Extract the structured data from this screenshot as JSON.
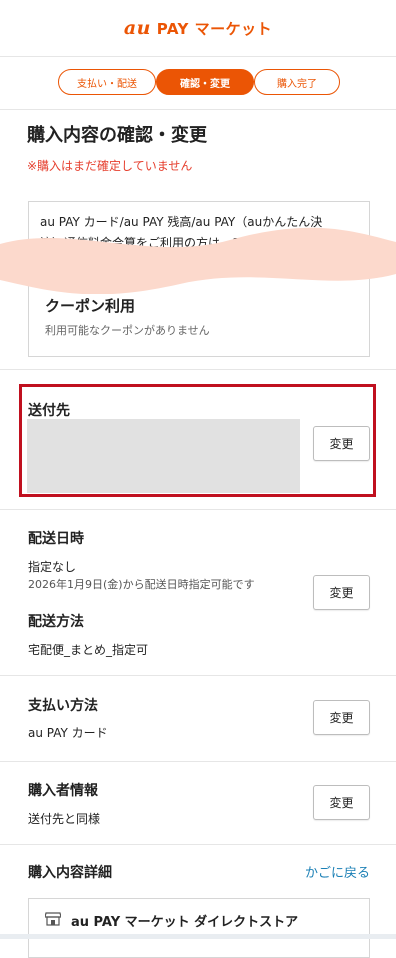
{
  "header": {
    "logo_au": "au",
    "logo_text": "PAY マーケット"
  },
  "steps": [
    {
      "label": "支払い・配送"
    },
    {
      "label": "確認・変更"
    },
    {
      "label": "購入完了"
    }
  ],
  "page": {
    "title": "購入内容の確認・変更",
    "warning": "※購入はまだ確定していません",
    "warning_color": "#e63f2e",
    "accent_color": "#eb5505"
  },
  "notice": {
    "line1": "au PAY カード/au PAY 残高/au PAY（auかんたん決",
    "line2": "済）通信料金合算をご利用の方は、SMSをお客様のス"
  },
  "coupon": {
    "title": "クーポン利用",
    "subtitle": "利用可能なクーポンがありません"
  },
  "shipping_address": {
    "title": "送付先",
    "change_label": "変更"
  },
  "delivery": {
    "date_title": "配送日時",
    "date_value": "指定なし",
    "date_note": "2026年1月9日(金)から配送日時指定可能です",
    "method_title": "配送方法",
    "method_value": "宅配便_まとめ_指定可",
    "change_label": "変更"
  },
  "payment": {
    "title": "支払い方法",
    "value": "au PAY カード",
    "change_label": "変更"
  },
  "buyer": {
    "title": "購入者情報",
    "value": "送付先と同様",
    "change_label": "変更"
  },
  "details": {
    "title": "購入内容詳細",
    "back_link": "かごに戻る",
    "shop_name": "au PAY マーケット ダイレクトストア"
  }
}
